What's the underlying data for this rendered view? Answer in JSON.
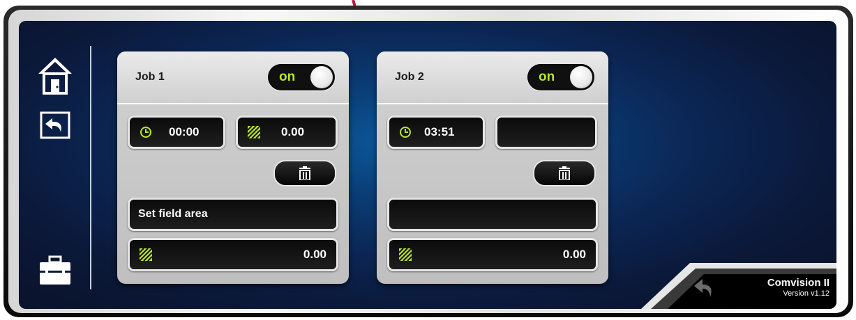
{
  "nav": {
    "home": "home-icon",
    "back": "back-arrow-icon",
    "toolbox": "toolbox-icon"
  },
  "jobs": [
    {
      "title": "Job 1",
      "toggle_label": "on",
      "time": "00:00",
      "area": "0.00",
      "field_label": "Set field area",
      "total_area": "0.00"
    },
    {
      "title": "Job 2",
      "toggle_label": "on",
      "time": "03:51",
      "area": "",
      "field_label": "",
      "total_area": "0.00"
    }
  ],
  "brand": {
    "name": "Comvision II",
    "version": "Version v1.12"
  },
  "colors": {
    "accent": "#b8e624",
    "annotation_arrow": "#c0143c",
    "screen_blue": "#0d5a9e"
  }
}
